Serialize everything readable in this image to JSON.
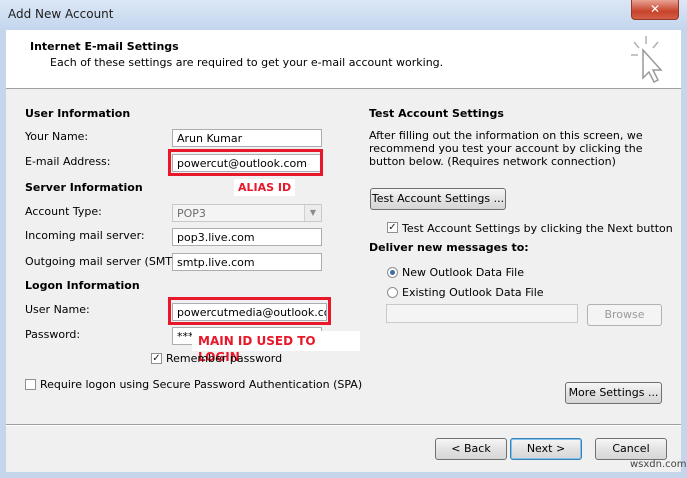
{
  "window": {
    "title": "Add New Account",
    "close_label": "✕"
  },
  "header": {
    "title": "Internet E-mail Settings",
    "subtitle": "Each of these settings are required to get your e-mail account working."
  },
  "user_info": {
    "heading": "User Information",
    "name_label": "Your Name:",
    "name_value": "Arun Kumar",
    "email_label": "E-mail Address:",
    "email_value": "powercut@outlook.com"
  },
  "server_info": {
    "heading": "Server Information",
    "account_type_label": "Account Type:",
    "account_type_value": "POP3",
    "incoming_label": "Incoming mail server:",
    "incoming_value": "pop3.live.com",
    "outgoing_label": "Outgoing mail server (SMTP):",
    "outgoing_value": "smtp.live.com"
  },
  "logon_info": {
    "heading": "Logon Information",
    "username_label": "User Name:",
    "username_value": "powercutmedia@outlook.com",
    "password_label": "Password:",
    "password_value": "***",
    "remember_label": "Remember password",
    "remember_checked": true,
    "spa_label": "Require logon using Secure Password Authentication (SPA)",
    "spa_checked": false
  },
  "annotations": {
    "alias": "ALIAS ID",
    "main": "MAIN ID USED TO LOGIN",
    "color": "#e8182a"
  },
  "test_settings": {
    "heading": "Test Account Settings",
    "description": "After filling out the information on this screen, we recommend you test your account by clicking the button below. (Requires network connection)",
    "button_label": "Test Account Settings ...",
    "auto_test_label": "Test Account Settings by clicking the Next button",
    "auto_test_checked": true
  },
  "deliver": {
    "heading": "Deliver new messages to:",
    "option_new": "New Outlook Data File",
    "option_existing": "Existing Outlook Data File",
    "selected": "new",
    "path_value": "",
    "browse_label": "Browse"
  },
  "buttons": {
    "more_settings": "More Settings ...",
    "back": "< Back",
    "next": "Next >",
    "cancel": "Cancel"
  },
  "watermark": "wsxdn.com"
}
